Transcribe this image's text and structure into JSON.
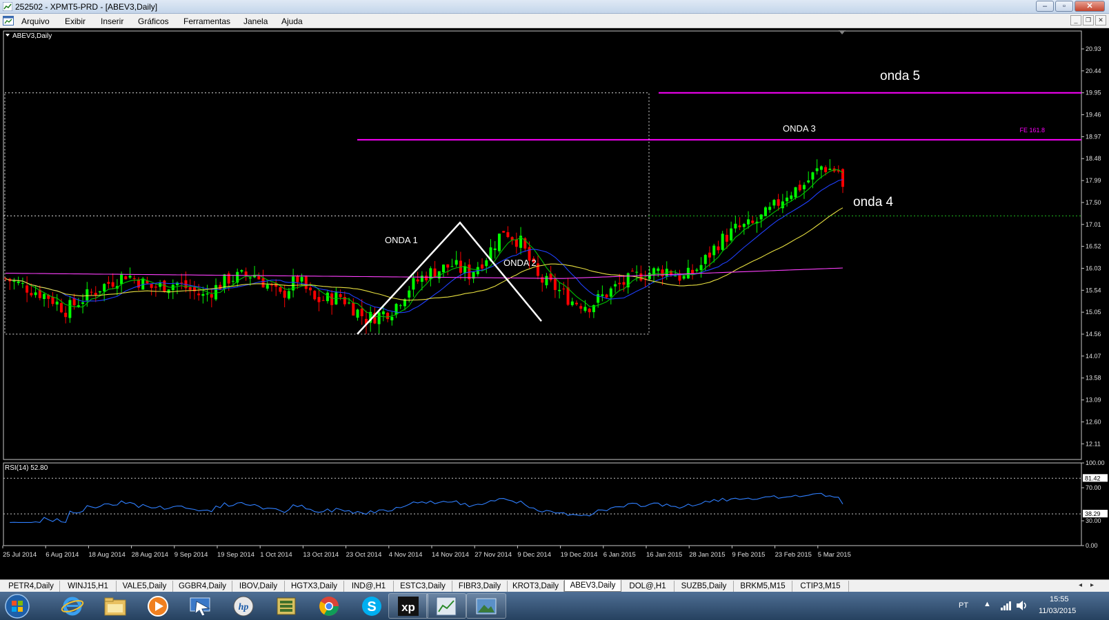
{
  "window": {
    "title": "252502 - XPMT5-PRD - [ABEV3,Daily]",
    "minimize": "‒",
    "maximize": "▫",
    "close": "✕"
  },
  "menu": [
    "Arquivo",
    "Exibir",
    "Inserir",
    "Gráficos",
    "Ferramentas",
    "Janela",
    "Ajuda"
  ],
  "chart": {
    "symbol_label": "ABEV3,Daily",
    "price_ticks": [
      "20.93",
      "20.44",
      "19.95",
      "19.46",
      "18.97",
      "18.48",
      "17.99",
      "17.50",
      "17.01",
      "16.52",
      "16.03",
      "15.54",
      "15.05",
      "14.56",
      "14.07",
      "13.58",
      "13.09",
      "12.60",
      "12.11"
    ],
    "price_range": [
      11.76,
      21.33
    ],
    "fe_label": "FE 161.8",
    "annotations": {
      "onda1": "ONDA 1",
      "onda2": "ONDA 2",
      "onda3": "ONDA 3",
      "onda4": "onda 4",
      "onda5": "onda 5"
    },
    "levels": {
      "onda5_line": 19.95,
      "fe_line": 18.9,
      "box_top": 19.95,
      "box_bottom": 14.56,
      "support_line": 17.2
    },
    "date_ticks": [
      "25 Jul 2014",
      "6 Aug 2014",
      "18 Aug 2014",
      "28 Aug 2014",
      "9 Sep 2014",
      "19 Sep 2014",
      "1 Oct 2014",
      "13 Oct 2014",
      "23 Oct 2014",
      "4 Nov 2014",
      "14 Nov 2014",
      "27 Nov 2014",
      "9 Dec 2014",
      "19 Dec 2014",
      "6 Jan 2015",
      "16 Jan 2015",
      "28 Jan 2015",
      "9 Feb 2015",
      "23 Feb 2015",
      "5 Mar 2015"
    ],
    "colors": {
      "bull": "#00ff00",
      "bear": "#ff0000",
      "ma_fast": "#00c000",
      "ma_mid": "#2040ff",
      "ma_slow": "#e8e040",
      "ma_long": "#ff40ff",
      "rsi": "#2f7fff",
      "fibo": "#ff00ff"
    }
  },
  "rsi": {
    "label": "RSI(14) 52.80",
    "ticks": [
      "100.00",
      "70.00",
      "30.00",
      "0.00"
    ],
    "level_high": "81.42",
    "level_low": "38.29"
  },
  "chart_tabs": [
    {
      "label": "PETR4,Daily",
      "active": false
    },
    {
      "label": "WINJ15,H1",
      "active": false
    },
    {
      "label": "VALE5,Daily",
      "active": false
    },
    {
      "label": "GGBR4,Daily",
      "active": false
    },
    {
      "label": "IBOV,Daily",
      "active": false
    },
    {
      "label": "HGTX3,Daily",
      "active": false
    },
    {
      "label": "IND@,H1",
      "active": false
    },
    {
      "label": "ESTC3,Daily",
      "active": false
    },
    {
      "label": "FIBR3,Daily",
      "active": false
    },
    {
      "label": "KROT3,Daily",
      "active": false
    },
    {
      "label": "ABEV3,Daily",
      "active": true
    },
    {
      "label": "DOL@,H1",
      "active": false
    },
    {
      "label": "SUZB5,Daily",
      "active": false
    },
    {
      "label": "BRKM5,M15",
      "active": false
    },
    {
      "label": "CTIP3,M15",
      "active": false
    }
  ],
  "taskbar": {
    "icons": [
      "start-orb-icon",
      "internet-explorer-icon",
      "file-explorer-icon",
      "media-player-icon",
      "remote-desktop-icon",
      "hp-icon",
      "app-icon",
      "chrome-icon",
      "skype-icon",
      "xp-investimentos-icon",
      "metatrader-icon",
      "image-viewer-icon"
    ],
    "lang": "PT",
    "time": "15:55",
    "date": "11/03/2015"
  }
}
